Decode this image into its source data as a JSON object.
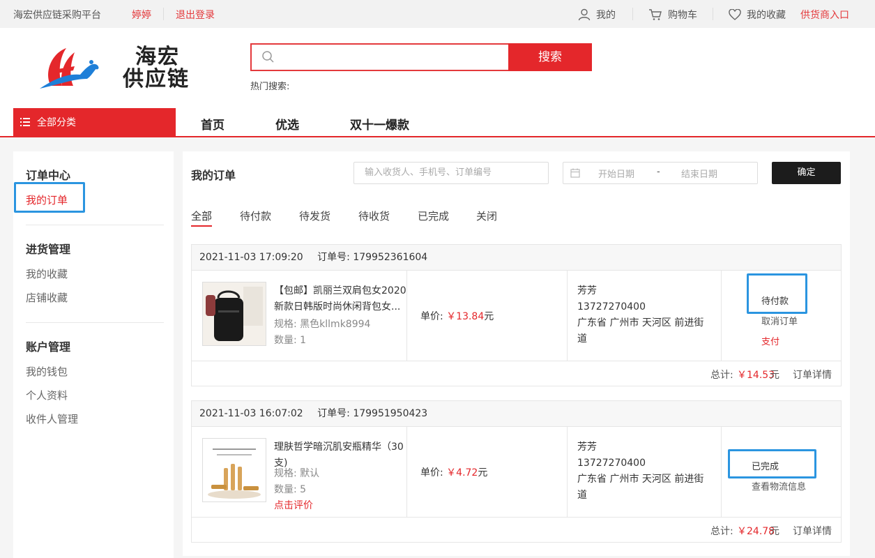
{
  "topbar": {
    "site_name": "海宏供应链采购平台",
    "username": "婷婷",
    "logout": "退出登录",
    "mine": "我的",
    "cart": "购物车",
    "favorites": "我的收藏",
    "supplier_entry": "供货商入口"
  },
  "header": {
    "logo_line1": "海宏",
    "logo_line2": "供应链",
    "search_placeholder": "",
    "search_button": "搜索",
    "hot_search_label": "热门搜索:"
  },
  "nav": {
    "all_categories": "全部分类",
    "links": [
      "首页",
      "优选",
      "双十一爆款"
    ]
  },
  "sidebar": {
    "sections": [
      {
        "title": "订单中心",
        "items": [
          "我的订单"
        ]
      },
      {
        "title": "进货管理",
        "items": [
          "我的收藏",
          "店铺收藏"
        ]
      },
      {
        "title": "账户管理",
        "items": [
          "我的钱包",
          "个人资料",
          "收件人管理"
        ]
      }
    ],
    "active_item": "我的订单"
  },
  "main": {
    "title": "我的订单",
    "search_placeholder": "输入收货人、手机号、订单编号",
    "start_date_placeholder": "开始日期",
    "date_separator": "-",
    "end_date_placeholder": "结束日期",
    "confirm_button": "确定",
    "tabs": [
      "全部",
      "待付款",
      "待发货",
      "待收货",
      "已完成",
      "关闭"
    ],
    "active_tab": "全部"
  },
  "orders": [
    {
      "datetime": "2021-11-03 17:09:20",
      "order_no": "订单号: 179952361604",
      "product_name": "【包邮】凯丽兰双肩包女2020新款日韩版时尚休闲背包女...",
      "spec": "规格: 黑色kllmk8994",
      "qty": "数量: 1",
      "review_link": "",
      "unit_price_label": "单价:",
      "unit_price": "￥13.84",
      "unit_price_suffix": "元",
      "receiver_name": "芳芳",
      "receiver_phone": "13727270400",
      "receiver_address": "广东省 广州市 天河区 前进街道",
      "status": "待付款",
      "actions": [
        "取消订单",
        "支付"
      ],
      "total_label": "总计:",
      "total": "￥14.53",
      "total_suffix": "元",
      "detail_link": "订单详情"
    },
    {
      "datetime": "2021-11-03 16:07:02",
      "order_no": "订单号: 179951950423",
      "product_name": "理肤哲学暗沉肌安瓶精华（30支)",
      "spec": "规格: 默认",
      "qty": "数量: 5",
      "review_link": "点击评价",
      "unit_price_label": "单价:",
      "unit_price": "￥4.72",
      "unit_price_suffix": "元",
      "receiver_name": "芳芳",
      "receiver_phone": "13727270400",
      "receiver_address": "广东省 广州市 天河区 前进街道",
      "status": "已完成",
      "actions": [
        "查看物流信息"
      ],
      "total_label": "总计:",
      "total": "￥24.78",
      "total_suffix": "元",
      "detail_link": "订单详情"
    }
  ],
  "colors": {
    "accent_red": "#e4272b",
    "highlight_blue": "#2b95e0"
  }
}
